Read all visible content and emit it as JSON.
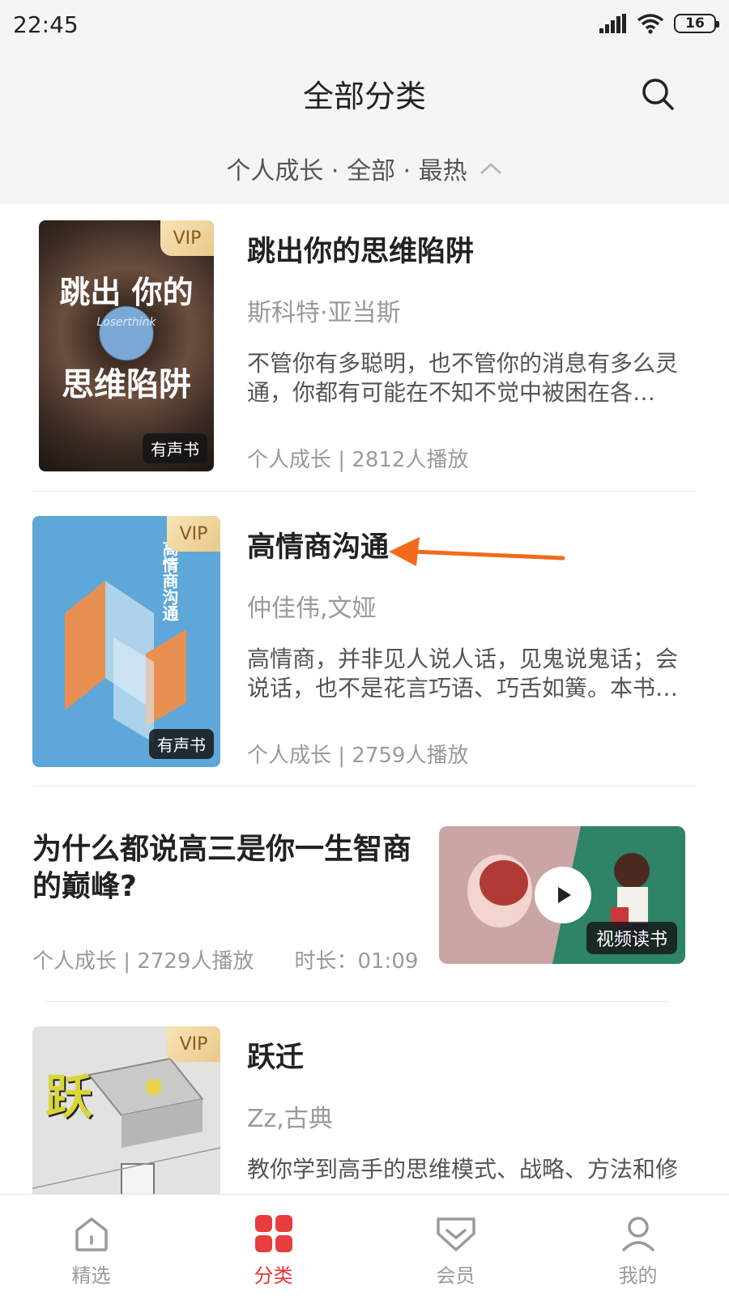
{
  "status_bar": {
    "time": "22:45",
    "battery": "16"
  },
  "header": {
    "title": "全部分类"
  },
  "filter": {
    "text": "个人成长 · 全部 · 最热"
  },
  "items": [
    {
      "title": "跳出你的思维陷阱",
      "author": "斯科特·亚当斯",
      "desc": "不管你有多聪明，也不管你的消息有多么灵通，你都有可能在不知不觉中被困在各…",
      "meta": "个人成长 | 2812人播放",
      "vip": "VIP",
      "type_badge": "有声书",
      "cover_title_1": "跳出 你的",
      "cover_title_2": "思维陷阱",
      "cover_sub": "Loserthink"
    },
    {
      "title": "高情商沟通",
      "author": "仲佳伟,文娅",
      "desc": "高情商，并非见人说人话，见鬼说鬼话；会说话，也不是花言巧语、巧舌如簧。本书…",
      "meta": "个人成长 | 2759人播放",
      "vip": "VIP",
      "type_badge": "有声书",
      "cover_title": "高情商沟通"
    },
    {
      "title": "跃迁",
      "author": "Zz,古典",
      "desc": "教你学到高手的思维模式、战略、方法和修炼…",
      "vip": "VIP",
      "cover_title": "跃"
    }
  ],
  "video": {
    "title": "为什么都说高三是你一生智商的巅峰?",
    "meta": "个人成长 | 2729人播放",
    "duration": "时长：01:09",
    "badge": "视频读书"
  },
  "nav": [
    {
      "label": "精选",
      "icon": "home-icon",
      "active": false
    },
    {
      "label": "分类",
      "icon": "category-grid-icon",
      "active": true
    },
    {
      "label": "会员",
      "icon": "vip-diamond-icon",
      "active": false
    },
    {
      "label": "我的",
      "icon": "profile-icon",
      "active": false
    }
  ],
  "colors": {
    "accent": "#e83d3d",
    "vip_gold": "#e9c98a",
    "arrow": "#f26b1d"
  }
}
